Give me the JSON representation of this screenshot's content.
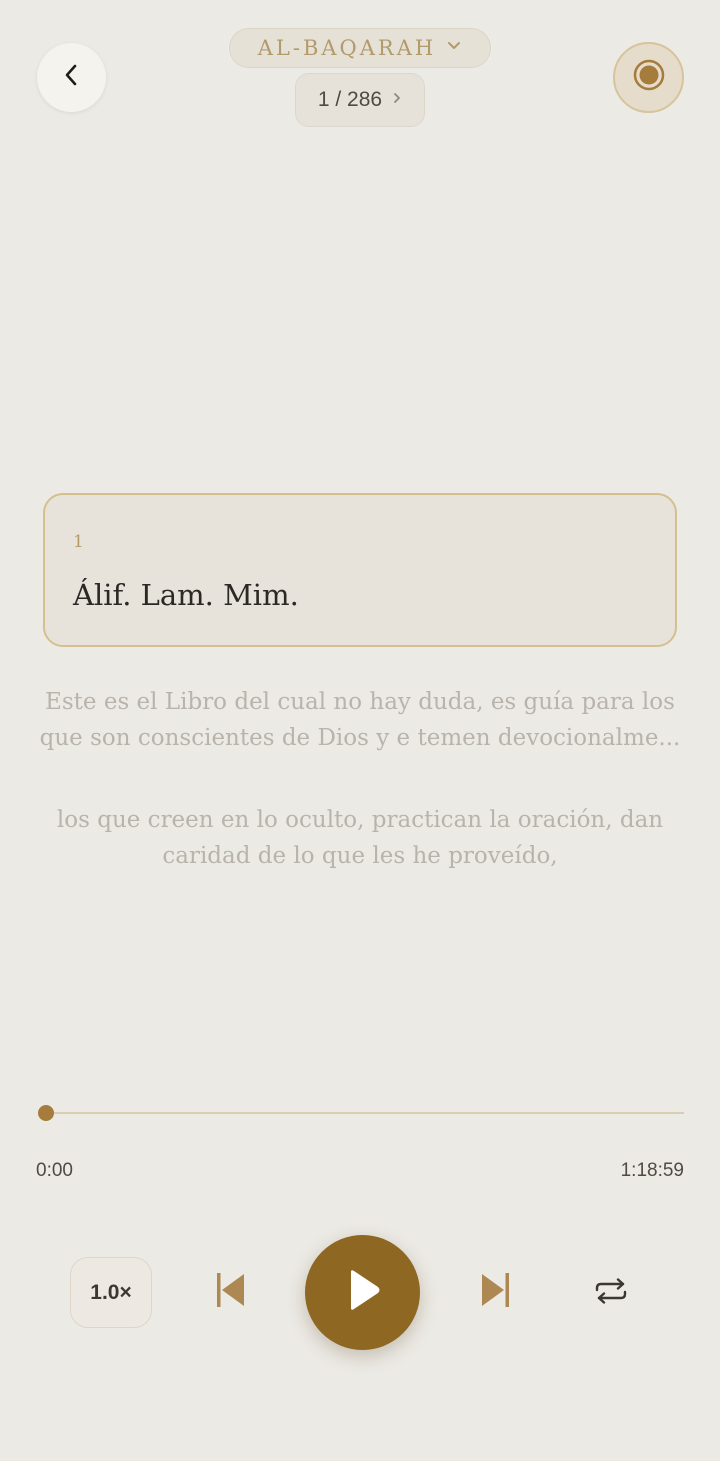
{
  "header": {
    "back_icon": "chevron-left-icon",
    "surah_name": "AL-BAQARAH",
    "surah_dropdown_icon": "chevron-down-icon",
    "verse_counter": "1 / 286",
    "verse_next_icon": "chevron-right-icon",
    "record_icon": "record-icon"
  },
  "current_verse": {
    "number": "1",
    "text": "Álif. Lam. Mim."
  },
  "upcoming_verses": [
    {
      "text_line1": "Este es el Libro del cual no hay duda, es guía para los",
      "text_line2": "que son conscientes de Dios y e temen devocionalme..."
    },
    {
      "text_line1": "los que creen en lo oculto, practican la oración, dan",
      "text_line2": "caridad de lo que les he proveído,"
    }
  ],
  "player": {
    "progress": 0,
    "current_time": "0:00",
    "total_time": "1:18:59",
    "speed": "1.0×",
    "prev_icon": "skip-previous-icon",
    "play_icon": "play-icon",
    "next_icon": "skip-next-icon",
    "repeat_icon": "repeat-icon"
  },
  "colors": {
    "background": "#eceae5",
    "accent": "#8e6722",
    "accent_light": "#b39a6a"
  }
}
